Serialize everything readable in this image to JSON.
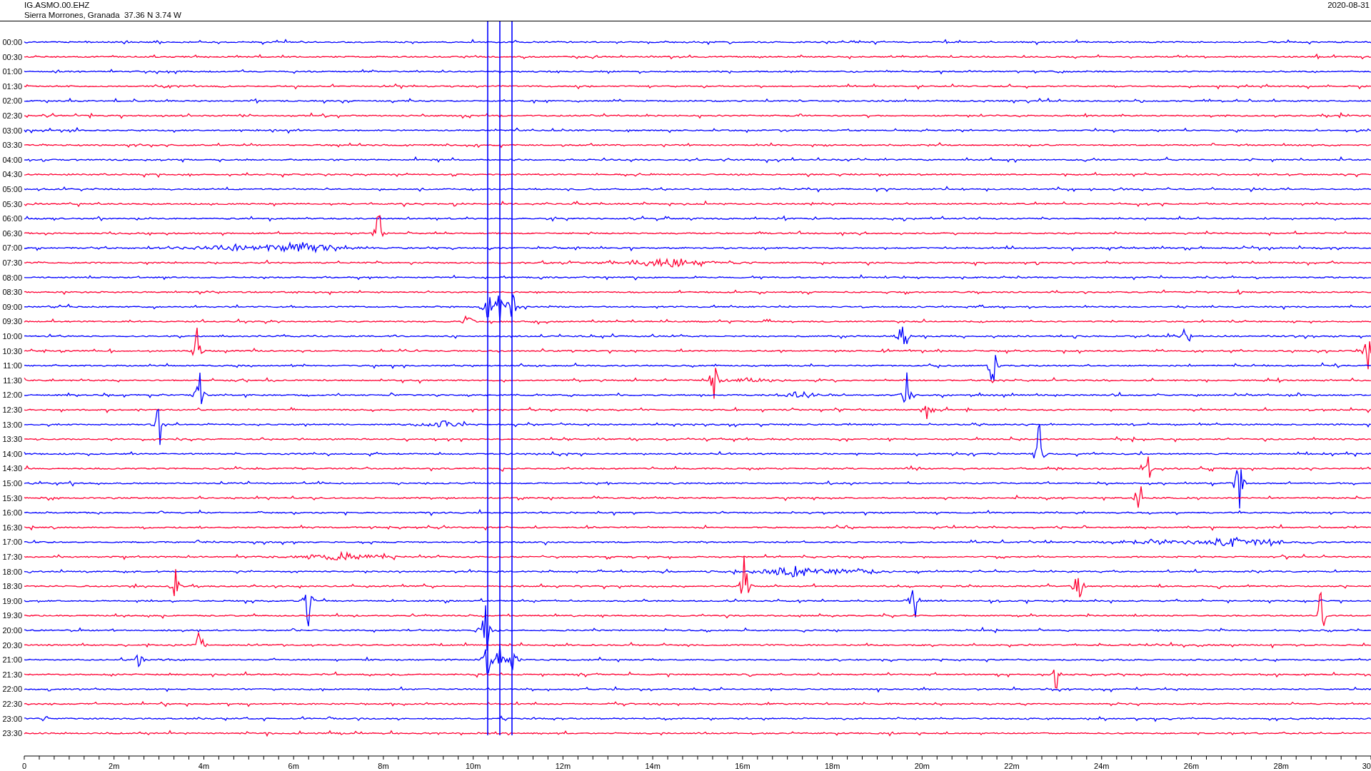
{
  "header": {
    "station": "IG.ASMO.00.EHZ",
    "location": "Sierra Morrones, Granada  37.36 N 3.74 W",
    "date": "2020-08-31"
  },
  "traces": [
    {
      "time": "00:00",
      "color": "#0000ff"
    },
    {
      "time": "00:30",
      "color": "#ff0033"
    },
    {
      "time": "01:00",
      "color": "#0000ff"
    },
    {
      "time": "01:30",
      "color": "#ff0033"
    },
    {
      "time": "02:00",
      "color": "#0000ff"
    },
    {
      "time": "02:30",
      "color": "#ff0033"
    },
    {
      "time": "03:00",
      "color": "#0000ff"
    },
    {
      "time": "03:30",
      "color": "#ff0033"
    },
    {
      "time": "04:00",
      "color": "#0000ff"
    },
    {
      "time": "04:30",
      "color": "#ff0033"
    },
    {
      "time": "05:00",
      "color": "#0000ff"
    },
    {
      "time": "05:30",
      "color": "#ff0033"
    },
    {
      "time": "06:00",
      "color": "#0000ff"
    },
    {
      "time": "06:30",
      "color": "#ff0033"
    },
    {
      "time": "07:00",
      "color": "#0000ff"
    },
    {
      "time": "07:30",
      "color": "#ff0033"
    },
    {
      "time": "08:00",
      "color": "#0000ff"
    },
    {
      "time": "08:30",
      "color": "#ff0033"
    },
    {
      "time": "09:00",
      "color": "#0000ff"
    },
    {
      "time": "09:30",
      "color": "#ff0033"
    },
    {
      "time": "10:00",
      "color": "#0000ff"
    },
    {
      "time": "10:30",
      "color": "#ff0033"
    },
    {
      "time": "11:00",
      "color": "#0000ff"
    },
    {
      "time": "11:30",
      "color": "#ff0033"
    },
    {
      "time": "12:00",
      "color": "#0000ff"
    },
    {
      "time": "12:30",
      "color": "#ff0033"
    },
    {
      "time": "13:00",
      "color": "#0000ff"
    },
    {
      "time": "13:30",
      "color": "#ff0033"
    },
    {
      "time": "14:00",
      "color": "#0000ff"
    },
    {
      "time": "14:30",
      "color": "#ff0033"
    },
    {
      "time": "15:00",
      "color": "#0000ff"
    },
    {
      "time": "15:30",
      "color": "#ff0033"
    },
    {
      "time": "16:00",
      "color": "#0000ff"
    },
    {
      "time": "16:30",
      "color": "#ff0033"
    },
    {
      "time": "17:00",
      "color": "#0000ff"
    },
    {
      "time": "17:30",
      "color": "#ff0033"
    },
    {
      "time": "18:00",
      "color": "#0000ff"
    },
    {
      "time": "18:30",
      "color": "#ff0033"
    },
    {
      "time": "19:00",
      "color": "#0000ff"
    },
    {
      "time": "19:30",
      "color": "#ff0033"
    },
    {
      "time": "20:00",
      "color": "#0000ff"
    },
    {
      "time": "20:30",
      "color": "#ff0033"
    },
    {
      "time": "21:00",
      "color": "#0000ff"
    },
    {
      "time": "21:30",
      "color": "#ff0033"
    },
    {
      "time": "22:00",
      "color": "#0000ff"
    },
    {
      "time": "22:30",
      "color": "#ff0033"
    },
    {
      "time": "23:00",
      "color": "#0000ff"
    },
    {
      "time": "23:30",
      "color": "#ff0033"
    }
  ],
  "x_axis": {
    "ticks": [
      "0",
      "2m",
      "4m",
      "6m",
      "8m",
      "10m",
      "12m",
      "14m",
      "16m",
      "18m",
      "20m",
      "22m",
      "24m",
      "26m",
      "28m",
      "30"
    ]
  }
}
